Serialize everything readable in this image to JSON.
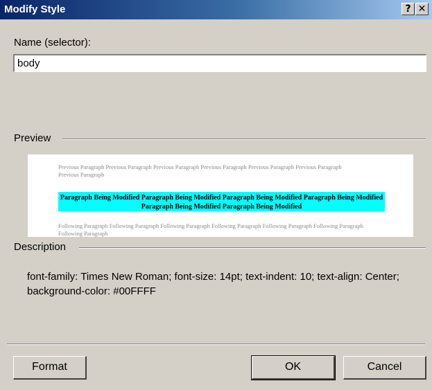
{
  "window": {
    "title": "Modify Style",
    "help_button": "?",
    "close_button": "✕"
  },
  "name_field": {
    "label": "Name (selector):",
    "value": "body"
  },
  "preview": {
    "group_label": "Preview",
    "previous_paragraph": "Previous Paragraph Previous Paragraph Previous Paragraph Previous Paragraph Previous Paragraph Previous Paragraph Previous Paragraph",
    "modified_paragraph": "Paragraph Being Modified Paragraph Being Modified Paragraph Being Modified Paragraph Being Modified Paragraph Being Modified Paragraph Being Modified",
    "following_paragraph": "Following Paragraph Following Paragraph Following Paragraph Following Paragraph Following Paragraph Following Paragraph Following Paragraph",
    "modified_background": "#00FFFF"
  },
  "description": {
    "group_label": "Description",
    "text": "font-family: Times New Roman; font-size: 14pt; text-indent: 10; text-align: Center; background-color: #00FFFF"
  },
  "buttons": {
    "format": "Format",
    "ok": "OK",
    "cancel": "Cancel"
  }
}
